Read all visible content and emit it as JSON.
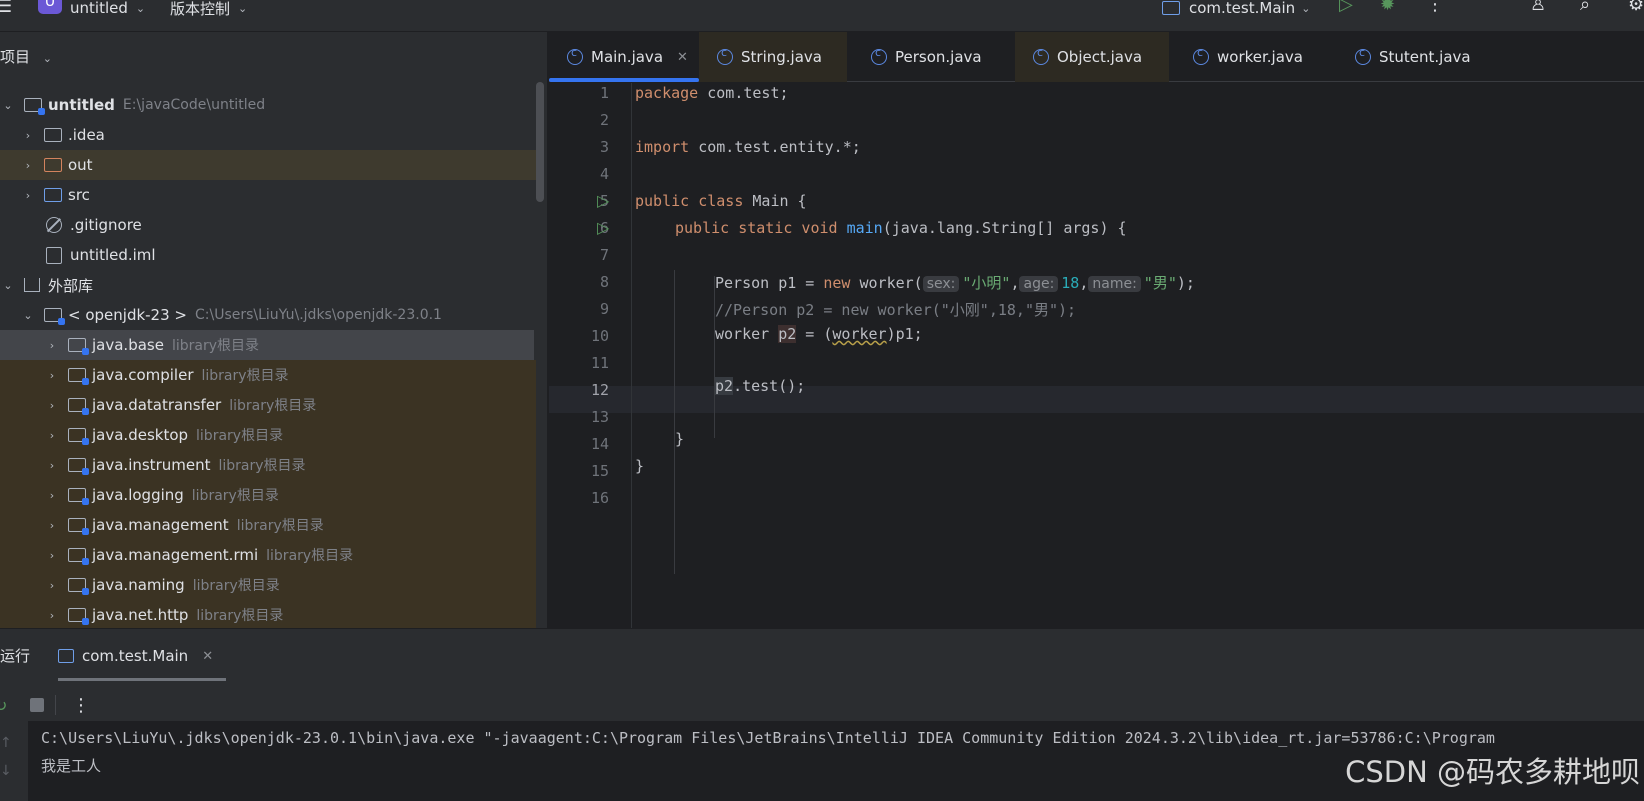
{
  "topbar": {
    "project_badge": "U",
    "project_name": "untitled",
    "vcs_label": "版本控制",
    "run_config": "com.test.Main"
  },
  "project_panel": {
    "header": "项目",
    "tree": [
      {
        "label": "untitled",
        "secondary": "E:\\javaCode\\untitled"
      },
      {
        "label": ".idea"
      },
      {
        "label": "out"
      },
      {
        "label": "src"
      },
      {
        "label": ".gitignore"
      },
      {
        "label": "untitled.iml"
      },
      {
        "label": "外部库"
      },
      {
        "label": "< openjdk-23 >",
        "secondary": "C:\\Users\\LiuYu\\.jdks\\openjdk-23.0.1"
      },
      {
        "label": "java.base",
        "secondary": "library根目录"
      },
      {
        "label": "java.compiler",
        "secondary": "library根目录"
      },
      {
        "label": "java.datatransfer",
        "secondary": "library根目录"
      },
      {
        "label": "java.desktop",
        "secondary": "library根目录"
      },
      {
        "label": "java.instrument",
        "secondary": "library根目录"
      },
      {
        "label": "java.logging",
        "secondary": "library根目录"
      },
      {
        "label": "java.management",
        "secondary": "library根目录"
      },
      {
        "label": "java.management.rmi",
        "secondary": "library根目录"
      },
      {
        "label": "java.naming",
        "secondary": "library根目录"
      },
      {
        "label": "java.net.http",
        "secondary": "library根目录"
      }
    ]
  },
  "editor": {
    "tabs": [
      {
        "label": "Main.java"
      },
      {
        "label": "String.java"
      },
      {
        "label": "Person.java"
      },
      {
        "label": "Object.java"
      },
      {
        "label": "worker.java"
      },
      {
        "label": "Stutent.java"
      }
    ],
    "line_numbers": [
      "1",
      "2",
      "3",
      "4",
      "5",
      "6",
      "7",
      "8",
      "9",
      "10",
      "11",
      "12",
      "13",
      "14",
      "15",
      "16"
    ],
    "code": {
      "l1_kw": "package",
      "l1_rest": " com.test;",
      "l3_kw": "import",
      "l3_rest": " com.test.entity.*;",
      "l5_kw": "public class",
      "l5_rest": " Main {",
      "l6_kw": "public static void",
      "l6_fn": "main",
      "l6_rest": "(java.lang.String[] args) {",
      "l8_a": "Person p1 = ",
      "l8_kw": "new",
      "l8_b": " worker(",
      "l8_hint_sex": "sex:",
      "l8_s1": "\"小明\"",
      "l8_c1": ",",
      "l8_hint_age": "age:",
      "l8_n": "18",
      "l8_c2": ",",
      "l8_hint_name": "name:",
      "l8_s2": "\"男\"",
      "l8_end": ");",
      "l9": "//Person p2 = new worker(\"小刚\",18,\"男\");",
      "l10_a": "worker ",
      "l10_var": "p2",
      "l10_b": " = (",
      "l10_cast": "worker",
      "l10_c": ")p1;",
      "l12_var": "p2",
      "l12_rest": ".test();",
      "l14": "}",
      "l15": "}"
    }
  },
  "run_panel": {
    "title": "运行",
    "tab_label": "com.test.Main",
    "console": [
      "C:\\Users\\LiuYu\\.jdks\\openjdk-23.0.1\\bin\\java.exe \"-javaagent:C:\\Program Files\\JetBrains\\IntelliJ IDEA Community Edition 2024.3.2\\lib\\idea_rt.jar=53786:C:\\Program",
      "我是工人"
    ]
  },
  "watermark": "CSDN @码农多耕地呗"
}
